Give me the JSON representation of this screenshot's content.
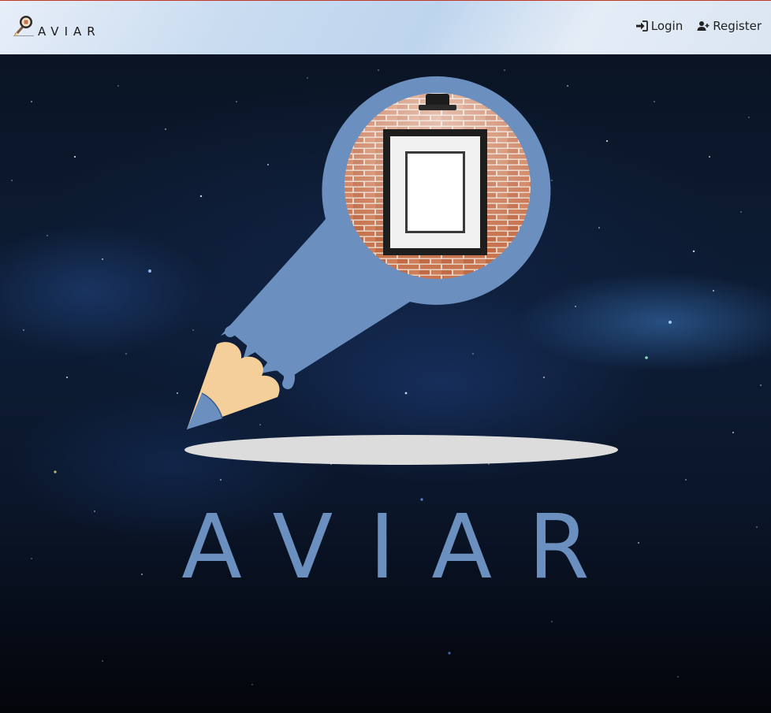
{
  "navbar": {
    "brand_text": "AVIAR",
    "brand_icon": "magnifier-pencil-logo-icon",
    "links": [
      {
        "label": "Login",
        "icon": "sign-in-icon"
      },
      {
        "label": "Register",
        "icon": "user-plus-icon"
      }
    ]
  },
  "hero": {
    "title": "AVIAR",
    "logo_icon": "pencil-magnifier-frame-logo"
  },
  "colors": {
    "navbar_gradient_light": "#e7eef8",
    "navbar_gradient_blue": "#bed5ee",
    "navbar_top_border": "#c0392b",
    "logo_blue": "#6b90bf",
    "pencil_tip": "#f4cf9a",
    "brick": "#c6714c",
    "title_color": "#6b90bf"
  }
}
